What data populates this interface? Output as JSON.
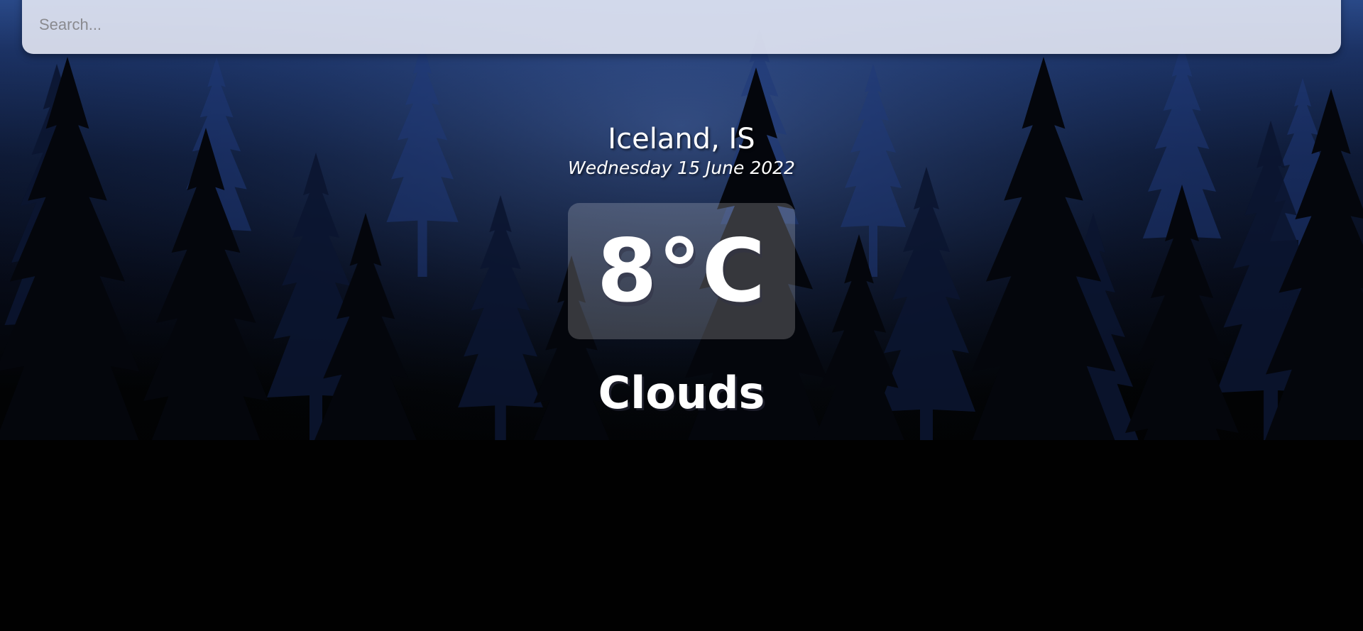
{
  "search": {
    "placeholder": "Search...",
    "value": ""
  },
  "location": {
    "name": "Iceland, IS",
    "date": "Wednesday 15 June 2022"
  },
  "weather": {
    "temperature": "8°C",
    "condition": "Clouds"
  },
  "background": {
    "scene": "misty-pine-forest",
    "colors": {
      "sky_top": "#2a4a8a",
      "sky_mid": "#0e1a36",
      "ground": "#010101",
      "far_trees": "#1f3a78",
      "mid_trees": "#0c1630",
      "near_trees": "#04060c"
    }
  }
}
